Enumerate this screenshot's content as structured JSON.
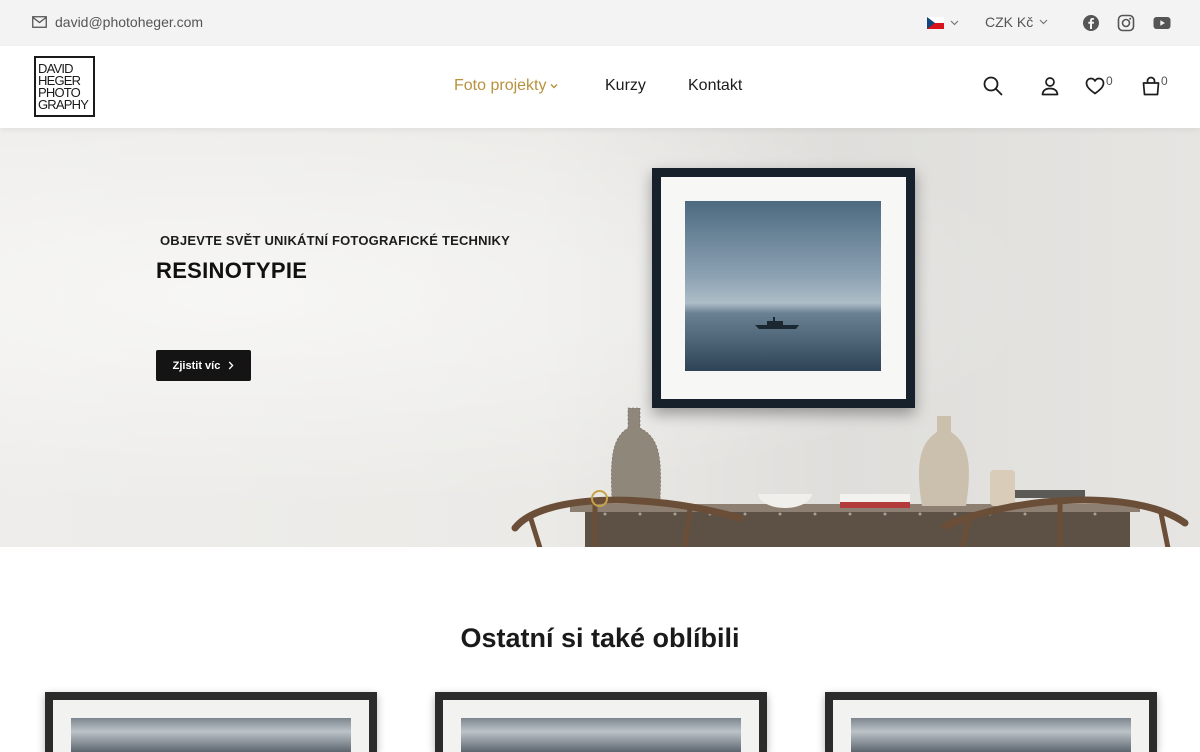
{
  "topbar": {
    "email": "david@photoheger.com",
    "language": "cz-flag",
    "currency": "CZK Kč",
    "social": [
      "facebook-icon",
      "instagram-icon",
      "youtube-icon"
    ]
  },
  "header": {
    "logo_lines": [
      "DAVID",
      "HEGER",
      "PHOTO",
      "GRAPHY"
    ],
    "nav": [
      {
        "label": "Foto projekty",
        "active": true,
        "dropdown": true
      },
      {
        "label": "Kurzy"
      },
      {
        "label": "Kontakt"
      }
    ],
    "wishlist_count": "0",
    "cart_count": "0",
    "accent_color": "#b8923e"
  },
  "hero": {
    "eyebrow": "OBJEVTE SVĚT UNIKÁTNÍ FOTOGRAFICKÉ TECHNIKY",
    "title": "RESINOTYPIE",
    "cta_label": "Zjistit víc"
  },
  "section": {
    "title": "Ostatní si také oblíbili"
  }
}
